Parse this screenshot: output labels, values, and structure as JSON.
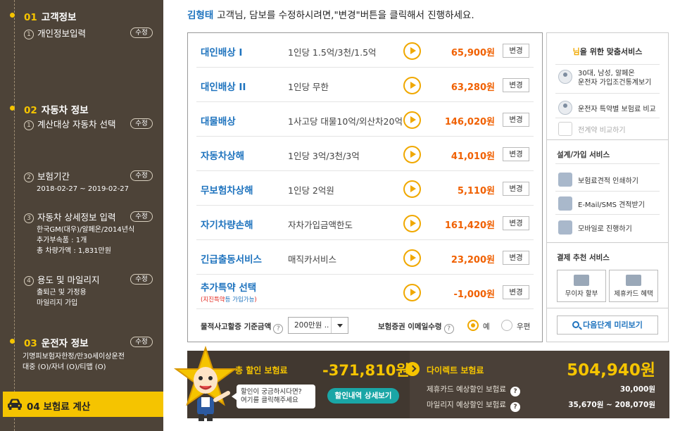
{
  "sidebar": {
    "steps": [
      {
        "num": "01",
        "title": "고객정보"
      },
      {
        "num": "02",
        "title": "자동차 정보"
      },
      {
        "num": "03",
        "title": "운전자 정보"
      },
      {
        "num": "04",
        "title": "보험료 계산"
      }
    ],
    "edit_label": "수정",
    "customer_sub": {
      "index": "1",
      "label": "개인정보입력"
    },
    "car_subs": [
      {
        "index": "1",
        "label": "계산대상 자동차 선택"
      },
      {
        "index": "2",
        "label": "보험기간",
        "detail": [
          "2018-02-27 ~ 2019-02-27"
        ]
      },
      {
        "index": "3",
        "label": "자동차 상세정보 입력",
        "detail": [
          "한국GM(대우)/알페온/2014년식",
          "추가부속품 : 1개",
          "총 차량가액 : 1,831만원"
        ]
      },
      {
        "index": "4",
        "label": "용도 및 마일리지",
        "detail": [
          "출퇴근 및 가정용",
          "마일리지 가입"
        ]
      }
    ],
    "driver_detail": [
      "기명피보험자한정/만30세이상운전",
      "대중 (O)/자녀 (O)/티맵 (O)"
    ]
  },
  "instruction": {
    "user_name": "김형태",
    "text": "고객님, 담보를 수정하시려면,\"변경\"버튼을 클릭해서 진행하세요."
  },
  "coverages": [
    {
      "name": "대인배상 I",
      "desc": "1인당 1.5억/3천/1.5억",
      "price": "65,900원"
    },
    {
      "name": "대인배상 II",
      "desc": "1인당 무한",
      "price": "63,280원"
    },
    {
      "name": "대물배상",
      "desc": "1사고당 대물10억/외산차20억",
      "price": "146,020원"
    },
    {
      "name": "자동차상해",
      "desc": "1인당 3억/3천/3억",
      "price": "41,010원"
    },
    {
      "name": "무보험차상해",
      "desc": "1인당 2억원",
      "price": "5,110원"
    },
    {
      "name": "자기차량손해",
      "desc": "자차가입금액한도",
      "price": "161,420원"
    },
    {
      "name": "긴급출동서비스",
      "desc": "매직카서비스",
      "price": "23,200원"
    },
    {
      "name": "추가특약 선택",
      "sub_pre": "(지진특약",
      "sub_mid": "등 가입가능",
      "sub_post": ")",
      "desc": "",
      "price": "-1,000원"
    }
  ],
  "change_label": "변경",
  "coverage_footer": {
    "property_label": "물적사고할증 기준금액",
    "property_value": "200만원 ..",
    "email_label": "보험증권 이메일수령",
    "yes": "예",
    "no": "우편"
  },
  "side_panel": {
    "title_hl": "님",
    "title_rest": "을 위한 맞춤서비스",
    "items": [
      {
        "line1": "30대, 남성, 알페온",
        "line2": "운전자 가입조건통계보기"
      },
      {
        "label": "운전자 특약별 보험료 비교"
      },
      {
        "label": "전계약 비교하기"
      }
    ],
    "design_head": "설계/가입 서비스",
    "design_items": [
      "보험료견적 인쇄하기",
      "E-Mail/SMS 견적받기",
      "모바일로 진행하기"
    ],
    "pay_head": "결제 추천 서비스",
    "pay_items": [
      "무이자 할부",
      "제휴카드 혜택"
    ],
    "next_label": "다음단계 미리보기"
  },
  "summary": {
    "discount_label": "총 할인 보험료",
    "discount_value": "-371,810원",
    "bubble_line1": "할인이 궁금하시다면?",
    "bubble_line2": "여기를 클릭해주세요",
    "detail_button": "할인내역 상세보기",
    "direct_label": "다이렉트 보험료",
    "direct_value": "504,940원",
    "card_label": "제휴카드 예상할인 보험료",
    "card_value": "30,000원",
    "mileage_label": "마일리지 예상할인 보험료",
    "mileage_value": "35,670원 ~ 208,070원"
  },
  "colors": {
    "accent_yellow": "#f5c400",
    "price_orange": "#f06000",
    "link_blue": "#1e73be",
    "sidebar_bg": "#4d4338"
  }
}
